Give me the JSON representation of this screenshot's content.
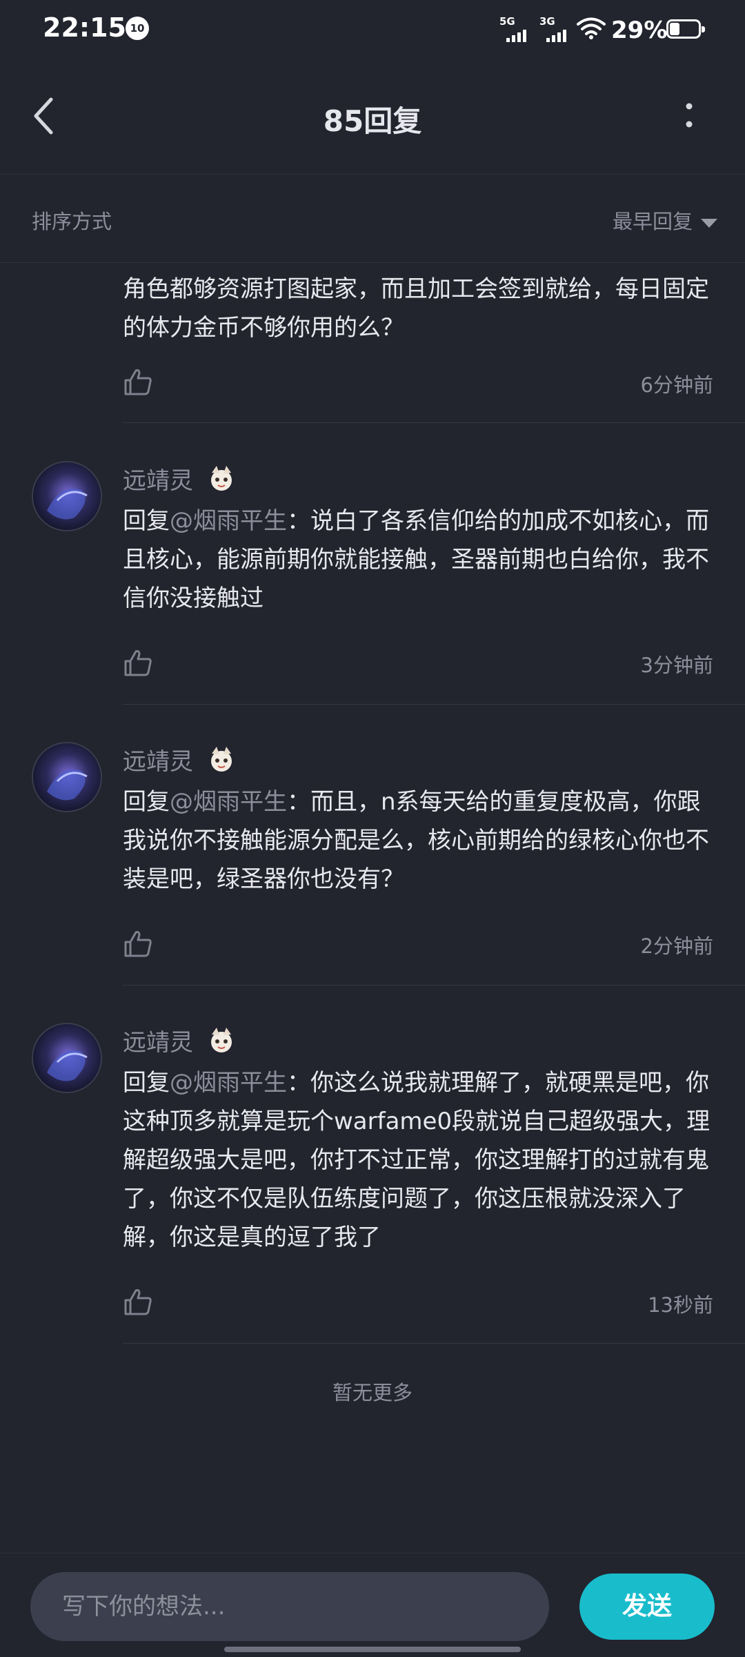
{
  "status_bar": {
    "time": "22:15",
    "notification_count": "10",
    "network_1": "5G",
    "network_2": "3G",
    "battery_percent": "29%",
    "battery_level": 0.29
  },
  "header": {
    "title": "85回复",
    "back_icon": "chevron-left-icon",
    "more_icon": "more-vertical-icon"
  },
  "sort": {
    "label": "排序方式",
    "selected": "最早回复"
  },
  "comments": [
    {
      "partial": true,
      "text": "角色都够资源打图起家，而且加工会签到就给，每日固定的体力金币不够你用的么？",
      "time": "6分钟前"
    },
    {
      "username": "远靖灵",
      "reply_prefix": "回复",
      "mention": "@烟雨平生",
      "text": "：说白了各系信仰给的加成不如核心，而且核心，能源前期你就能接触，圣器前期也白给你，我不信你没接触过",
      "time": "3分钟前"
    },
    {
      "username": "远靖灵",
      "reply_prefix": "回复",
      "mention": "@烟雨平生",
      "text": "：而且，n系每天给的重复度极高，你跟我说你不接触能源分配是么，核心前期给的绿核心你也不装是吧，绿圣器你也没有？",
      "time": "2分钟前"
    },
    {
      "username": "远靖灵",
      "reply_prefix": "回复",
      "mention": "@烟雨平生",
      "text": "：你这么说我就理解了，就硬黑是吧，你这种顶多就算是玩个warfame0段就说自己超级强大，理解超级强大是吧，你打不过正常，你这理解打的过就有鬼了，你这不仅是队伍练度问题了，你这压根就没深入了解，你这是真的逗了我了",
      "time": "13秒前"
    }
  ],
  "footer_note": "暂无更多",
  "input": {
    "placeholder": "写下你的想法...",
    "value": ""
  },
  "send_label": "发送",
  "colors": {
    "background": "#22242e",
    "accent": "#19bccb",
    "muted_text": "#8c8f9b",
    "text": "#e8e9ee"
  }
}
